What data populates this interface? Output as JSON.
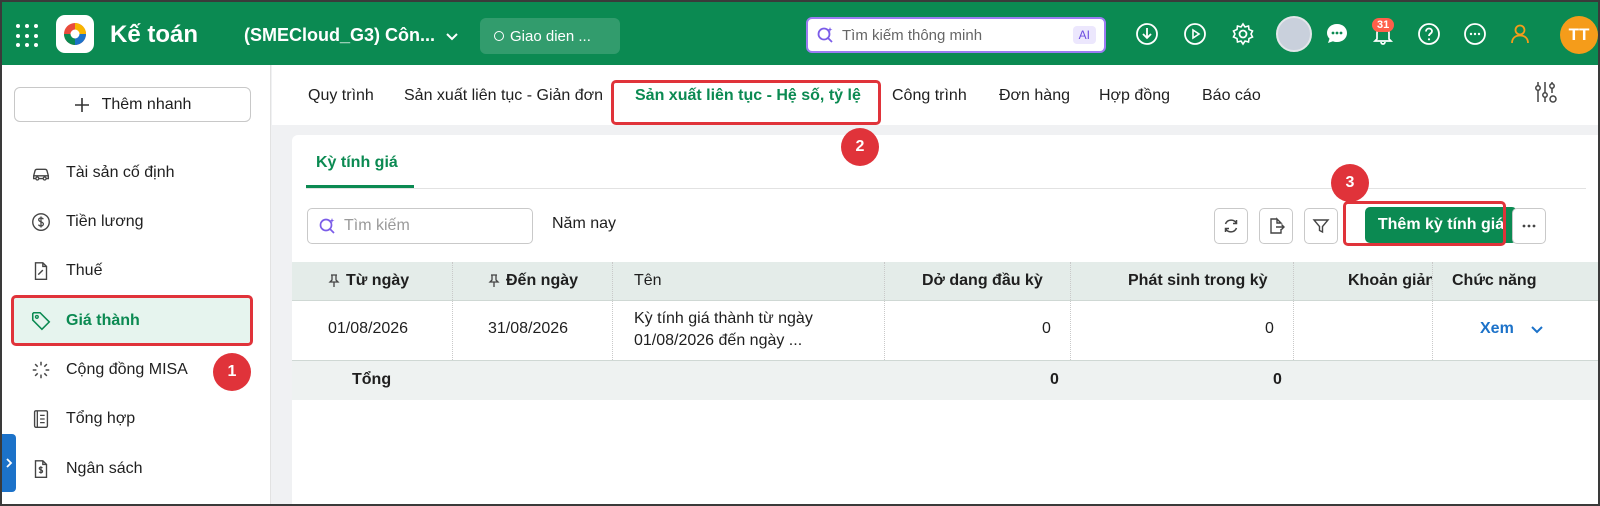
{
  "topbar": {
    "app_title": "Kế toán",
    "company": "(SMECloud_G3) Côn...",
    "ui_button": "Giao dien ...",
    "search_placeholder": "Tìm kiếm thông minh",
    "ai_label": "AI",
    "notification_count": "31",
    "user_initials": "TT",
    "brand_color": "#0b8a52"
  },
  "sidebar": {
    "quick_add": "Thêm nhanh",
    "items": [
      {
        "label": "Tài sản cố định",
        "icon": "car-icon"
      },
      {
        "label": "Tiền lương",
        "icon": "dollar-circle-icon"
      },
      {
        "label": "Thuế",
        "icon": "tax-document-icon"
      },
      {
        "label": "Giá thành",
        "icon": "price-tag-icon",
        "active": true
      },
      {
        "label": "Cộng đồng MISA",
        "icon": "community-icon"
      },
      {
        "label": "Tổng hợp",
        "icon": "ledger-icon"
      },
      {
        "label": "Ngân sách",
        "icon": "budget-icon"
      }
    ]
  },
  "tabs": [
    {
      "label": "Quy trình"
    },
    {
      "label": "Sản xuất liên tục - Giản đơn"
    },
    {
      "label": "Sản xuất liên tục - Hệ số, tỷ lệ",
      "active": true
    },
    {
      "label": "Công trình"
    },
    {
      "label": "Đơn hàng"
    },
    {
      "label": "Hợp đồng"
    },
    {
      "label": "Báo cáo"
    }
  ],
  "steps": [
    "1",
    "2",
    "3"
  ],
  "content": {
    "subtab": "Kỳ tính giá",
    "search_placeholder": "Tìm kiếm",
    "period": "Năm nay",
    "add_button": "Thêm kỳ tính giá",
    "table": {
      "headers": [
        "Từ ngày",
        "Đến ngày",
        "Tên",
        "Dở dang đầu kỳ",
        "Phát sinh trong kỳ",
        "Khoản giản",
        "Chức năng"
      ],
      "rows": [
        {
          "from": "01/08/2026",
          "to": "31/08/2026",
          "name_line1": "Kỳ tính giá thành từ ngày",
          "name_line2": "01/08/2026 đến ngày ...",
          "opening": "0",
          "incurred": "0",
          "reduction": "",
          "action": "Xem"
        }
      ],
      "total": {
        "label": "Tổng",
        "opening": "0",
        "incurred": "0"
      }
    }
  }
}
